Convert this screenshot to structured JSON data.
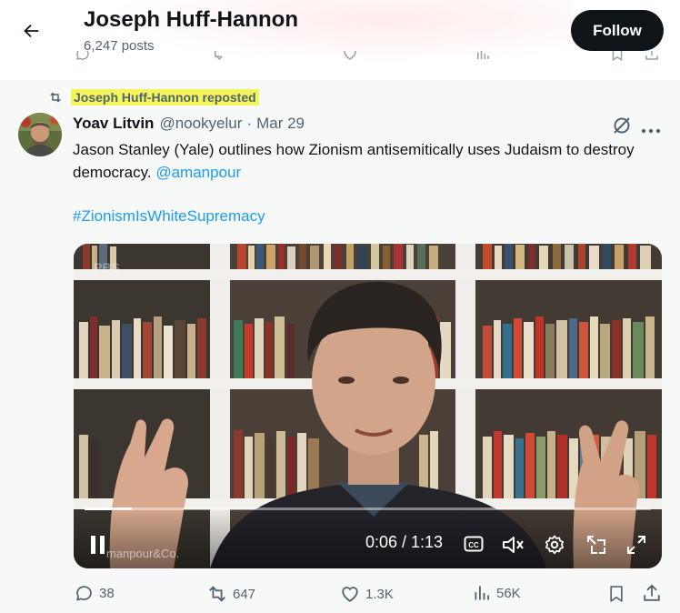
{
  "header": {
    "title": "Joseph Huff-Hannon",
    "subtitle": "6,247 posts",
    "follow_label": "Follow"
  },
  "post": {
    "repost_label": "Joseph Huff-Hannon reposted",
    "author_name": "Yoav Litvin",
    "author_handle": "@nookyelur",
    "separator": "·",
    "date": "Mar 29",
    "text": "Jason Stanley (Yale) outlines how Zionism antisemitically uses Judaism to destroy democracy.",
    "mention": "@amanpour",
    "hashtag": "#ZionismIsWhiteSupremacy"
  },
  "video": {
    "time": "0:06 / 1:13",
    "progress": 0.083,
    "watermark": "manpour&Co.",
    "corner_mark": "PBS"
  },
  "actions": {
    "replies": "38",
    "reposts": "647",
    "likes": "1.3K",
    "views": "56K"
  },
  "icons": [
    "back-arrow-icon",
    "repost-icon",
    "grok-icon",
    "more-icon",
    "pause-icon",
    "captions-icon",
    "mute-icon",
    "settings-icon",
    "pip-icon",
    "fullscreen-icon",
    "reply-icon",
    "like-icon",
    "views-icon",
    "bookmark-icon",
    "share-icon"
  ],
  "colors": {
    "accent": "#1d9bf0",
    "text": "#0f1419",
    "muted": "#536471",
    "highlight": "#f3f55a"
  }
}
